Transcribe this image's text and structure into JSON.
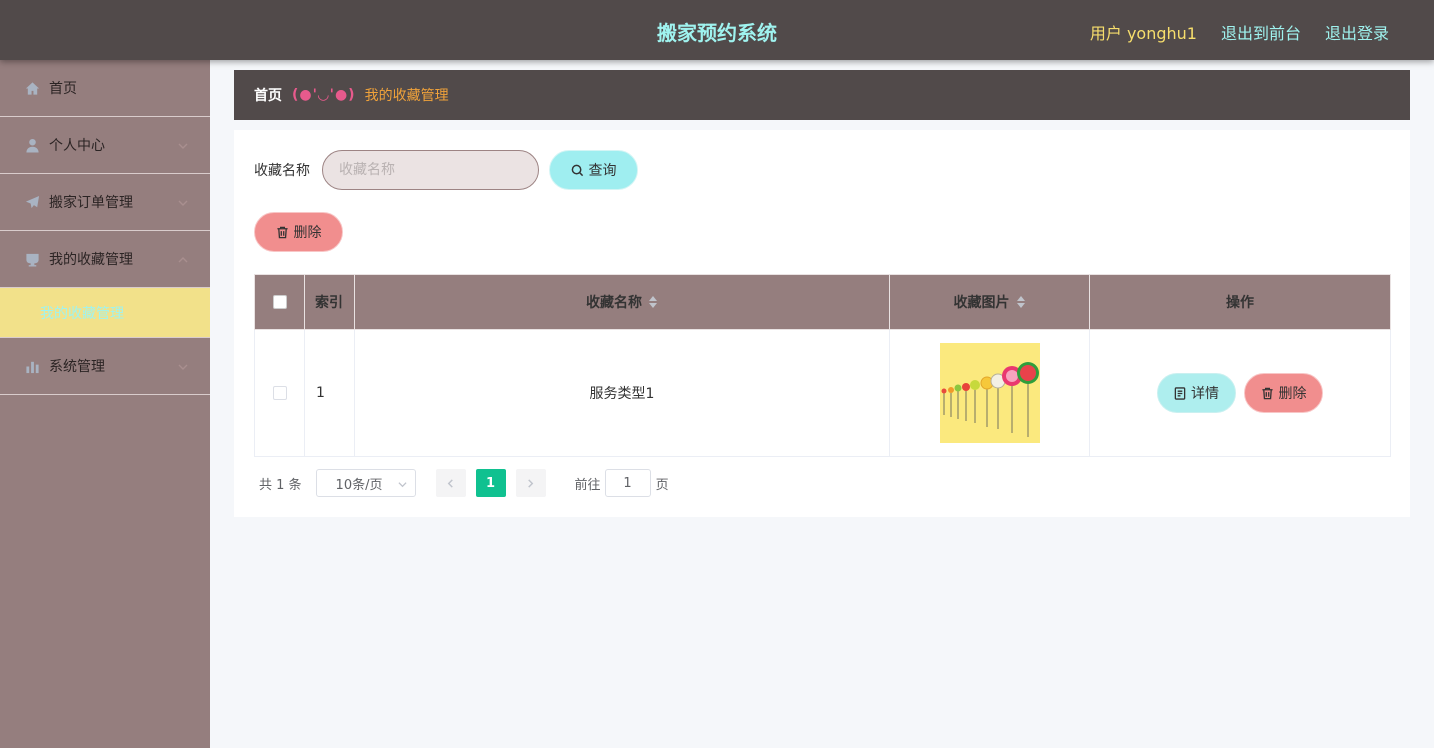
{
  "header": {
    "title": "搬家预约系统",
    "user_label": "用户 yonghu1",
    "to_frontend": "退出到前台",
    "logout": "退出登录"
  },
  "sidebar": {
    "items": [
      {
        "label": "首页",
        "icon": "home-icon"
      },
      {
        "label": "个人中心",
        "icon": "user-icon"
      },
      {
        "label": "搬家订单管理",
        "icon": "send-icon"
      },
      {
        "label": "我的收藏管理",
        "icon": "cup-icon"
      },
      {
        "label": "系统管理",
        "icon": "chart-icon"
      }
    ],
    "active_sub": "我的收藏管理"
  },
  "breadcrumb": {
    "home": "首页",
    "separator": "(●'◡'●)",
    "current": "我的收藏管理"
  },
  "search": {
    "label": "收藏名称",
    "placeholder": "收藏名称",
    "value": "",
    "query_button": "查询"
  },
  "actions": {
    "delete_button": "删除"
  },
  "table": {
    "columns": [
      "索引",
      "收藏名称",
      "收藏图片",
      "操作"
    ],
    "rows": [
      {
        "index": "1",
        "name": "服务类型1",
        "image": "fruit-slices-thumbnail",
        "detail": "详情",
        "delete": "删除"
      }
    ]
  },
  "pagination": {
    "total": "共 1 条",
    "page_size": "10条/页",
    "current_page": "1",
    "goto_label": "前往",
    "goto_value": "1",
    "page_suffix": "页"
  },
  "colors": {
    "topbar": "#514a4a",
    "sidebar": "#957e7e",
    "title": "#9ff3ef",
    "user": "#f7de6c",
    "active_sub_bg": "#f2e18a",
    "query_btn": "#9feef0",
    "delete_btn": "#f18e8e",
    "current_page": "#10c190"
  }
}
